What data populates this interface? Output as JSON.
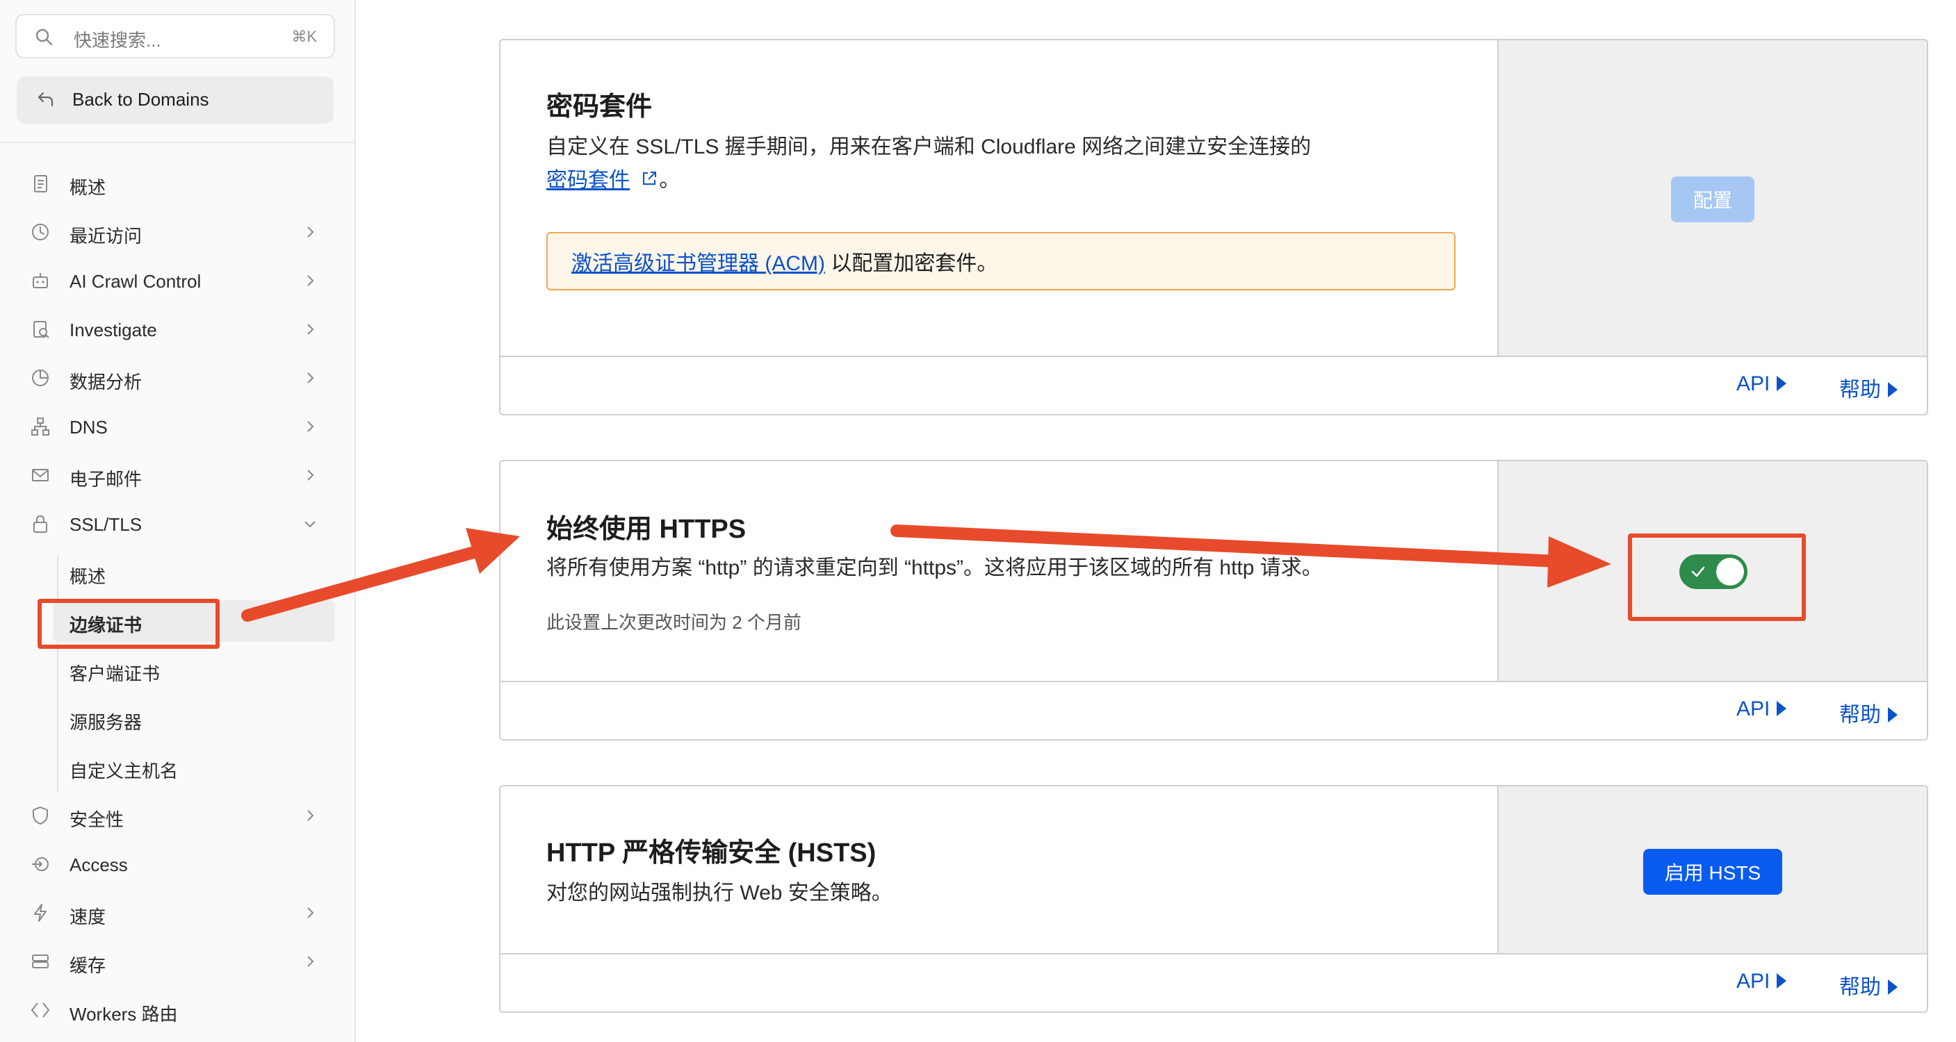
{
  "sidebar": {
    "search": {
      "placeholder": "快速搜索...",
      "shortcut": "⌘K"
    },
    "back_label": "Back to Domains",
    "items": [
      {
        "label": "概述",
        "icon": "document-icon"
      },
      {
        "label": "最近访问",
        "icon": "history-icon"
      },
      {
        "label": "AI Crawl Control",
        "icon": "robot-icon"
      },
      {
        "label": "Investigate",
        "icon": "investigate-icon"
      },
      {
        "label": "数据分析",
        "icon": "pie-chart-icon"
      },
      {
        "label": "DNS",
        "icon": "network-icon"
      },
      {
        "label": "电子邮件",
        "icon": "mail-icon"
      },
      {
        "label": "SSL/TLS",
        "icon": "lock-icon"
      },
      {
        "label": "安全性",
        "icon": "shield-icon"
      },
      {
        "label": "Access",
        "icon": "access-icon"
      },
      {
        "label": "速度",
        "icon": "lightning-icon"
      },
      {
        "label": "缓存",
        "icon": "cache-icon"
      },
      {
        "label": "Workers 路由",
        "icon": "workers-icon"
      }
    ],
    "ssl_sub_items": [
      {
        "label": "概述"
      },
      {
        "label": "边缘证书"
      },
      {
        "label": "客户端证书"
      },
      {
        "label": "源服务器"
      },
      {
        "label": "自定义主机名"
      }
    ]
  },
  "cards": {
    "cipher": {
      "title": "密码套件",
      "desc": "自定义在 SSL/TLS 握手期间，用来在客户端和 Cloudflare 网络之间建立安全连接的",
      "link": "密码套件",
      "link_suffix": "。",
      "note_link": "激活高级证书管理器 (ACM)",
      "note_text": " 以配置加密套件。",
      "button": "配置"
    },
    "https": {
      "title": "始终使用 HTTPS",
      "desc": "将所有使用方案 “http” 的请求重定向到 “https”。这将应用于该区域的所有 http 请求。",
      "modified": "此设置上次更改时间为 2 个月前",
      "toggle_on": true
    },
    "hsts": {
      "title": "HTTP 严格传输安全 (HSTS)",
      "desc": "对您的网站强制执行 Web 安全策略。",
      "button": "启用 HSTS"
    },
    "footer": {
      "api": "API",
      "help": "帮助"
    }
  },
  "colors": {
    "accent": "#0a52c9",
    "annotation": "#e84a2c",
    "toggle_on": "#2d8b4b",
    "button_primary": "#0a5cf0",
    "button_disabled": "#a6c7f4"
  }
}
